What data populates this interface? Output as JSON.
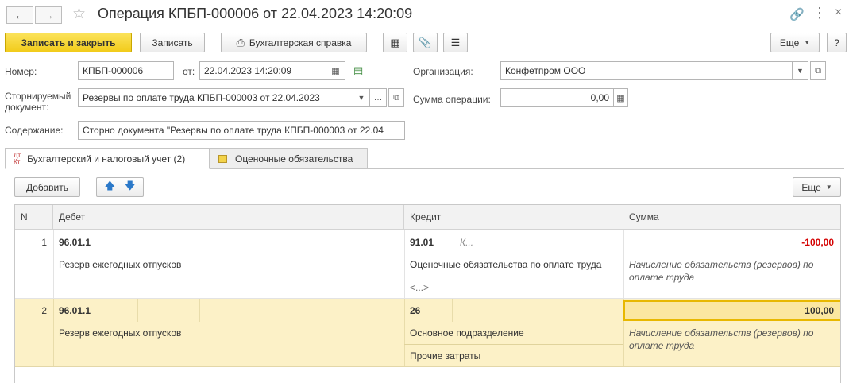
{
  "window": {
    "title": "Операция КПБП-000006 от 22.04.2023 14:20:09"
  },
  "toolbar": {
    "save_close": "Записать и закрыть",
    "save": "Записать",
    "report": "Бухгалтерская справка",
    "more": "Еще",
    "help": "?"
  },
  "form": {
    "number_label": "Номер:",
    "number_value": "КПБП-000006",
    "date_label": "от:",
    "date_value": "22.04.2023 14:20:09",
    "org_label": "Организация:",
    "org_value": "Конфетпром ООО",
    "storno_label_1": "Сторнируемый",
    "storno_label_2": "документ:",
    "storno_value": "Резервы по оплате труда КПБП-000003 от 22.04.2023",
    "sum_label": "Сумма операции:",
    "sum_value": "0,00",
    "content_label": "Содержание:",
    "content_value": "Сторно документа \"Резервы по оплате труда КПБП-000003 от 22.04"
  },
  "tabs": [
    {
      "label": "Бухгалтерский и налоговый учет (2)",
      "icon": "dt-kt-icon",
      "active": true
    },
    {
      "label": "Оценочные обязательства",
      "icon": "ledger-icon",
      "active": false
    }
  ],
  "table_toolbar": {
    "add": "Добавить",
    "more": "Еще"
  },
  "table": {
    "columns": [
      "N",
      "Дебет",
      "Кредит",
      "Сумма"
    ],
    "rows": [
      {
        "n": "1",
        "debit_account": "96.01.1",
        "debit_sub": "Резерв ежегодных отпусков",
        "credit_account": "91.01",
        "credit_extra": "К...",
        "credit_sub_1": "Оценочные обязательства по оплате труда",
        "credit_sub_2": "<...>",
        "amount": "-100,00",
        "comment_1": "Начисление обязательств (резервов) по",
        "comment_2": "оплате труда"
      },
      {
        "n": "2",
        "debit_account": "96.01.1",
        "debit_sub": "Резерв ежегодных отпусков",
        "credit_account": "26",
        "credit_sub_1": "Основное подразделение",
        "credit_sub_2": "Прочие затраты",
        "amount": "100,00",
        "comment_1": "Начисление обязательств (резервов) по",
        "comment_2": "оплате труда"
      }
    ]
  },
  "colors": {
    "primary_button": "#f2cc1b",
    "selected_row": "#fcf1c7",
    "negative_amount": "#d40000"
  }
}
